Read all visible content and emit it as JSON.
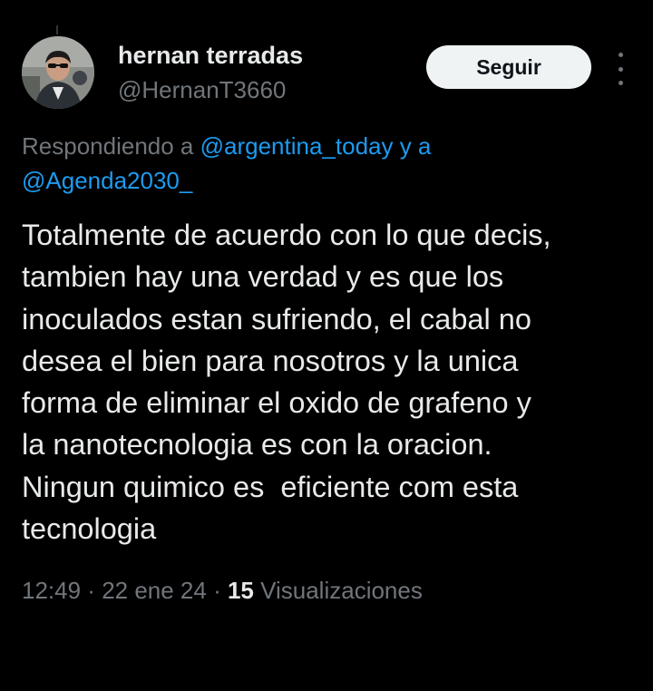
{
  "author": {
    "name": "hernan terradas",
    "handle": "@HernanT3660"
  },
  "actions": {
    "follow_label": "Seguir"
  },
  "reply": {
    "prefix": "Respondiendo a ",
    "mention1": "@argentina_today",
    "joiner": " y a ",
    "mention2": "@Agenda2030_"
  },
  "tweet": {
    "lines": [
      "Totalmente de acuerdo con lo que decis,",
      "tambien hay una verdad y es que los",
      "inoculados estan sufriendo, el cabal no",
      "desea el bien para nosotros y la unica",
      "forma de eliminar el oxido de grafeno y",
      "la nanotecnologia es con la oracion.",
      "Ningun quimico es  eficiente com esta",
      "tecnologia"
    ]
  },
  "meta": {
    "time": "12:49",
    "sep1": " · ",
    "date": "22 ene 24",
    "sep2": " · ",
    "views_count": "15",
    "views_label": " Visualizaciones"
  },
  "colors": {
    "background": "#000000",
    "text": "#e7e9ea",
    "secondary": "#71767b",
    "link": "#1d9bf0",
    "button_bg": "#eff3f4"
  }
}
